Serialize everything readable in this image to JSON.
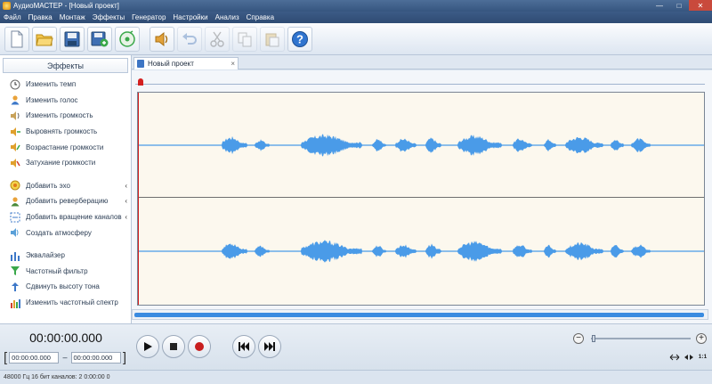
{
  "window": {
    "title": "АудиоМАСТЕР - [Новый проект]"
  },
  "menu": [
    "Файл",
    "Правка",
    "Монтаж",
    "Эффекты",
    "Генератор",
    "Настройки",
    "Анализ",
    "Справка"
  ],
  "toolbar": {
    "buttons": [
      {
        "name": "new-file",
        "icon": "new-file-icon",
        "enabled": true
      },
      {
        "name": "open",
        "icon": "folder-open-icon",
        "enabled": true
      },
      {
        "name": "save",
        "icon": "save-icon",
        "enabled": true
      },
      {
        "name": "save-as",
        "icon": "save-as-icon",
        "enabled": true
      },
      {
        "name": "record",
        "icon": "record-disc-icon",
        "enabled": true
      },
      {
        "name": "effects",
        "icon": "sound-effect-icon",
        "enabled": true
      },
      {
        "name": "undo",
        "icon": "undo-icon",
        "enabled": false
      },
      {
        "name": "cut",
        "icon": "scissors-icon",
        "enabled": false
      },
      {
        "name": "copy",
        "icon": "copy-icon",
        "enabled": false
      },
      {
        "name": "paste",
        "icon": "paste-icon",
        "enabled": false
      },
      {
        "name": "help",
        "icon": "help-icon",
        "enabled": true
      }
    ]
  },
  "sidebar": {
    "title": "Эффекты",
    "groups": [
      [
        {
          "label": "Изменить темп",
          "icon": "clock-icon"
        },
        {
          "label": "Изменить голос",
          "icon": "person-icon"
        },
        {
          "label": "Изменить громкость",
          "icon": "volume-icon"
        },
        {
          "label": "Выровнять громкость",
          "icon": "level-icon"
        },
        {
          "label": "Возрастание громкости",
          "icon": "fade-in-icon"
        },
        {
          "label": "Затухание громкости",
          "icon": "fade-out-icon"
        }
      ],
      [
        {
          "label": "Добавить эхо",
          "icon": "echo-icon",
          "arrow": "‹"
        },
        {
          "label": "Добавить реверберацию",
          "icon": "reverb-icon",
          "arrow": "‹"
        },
        {
          "label": "Добавить вращение каналов",
          "icon": "rotate-channels-icon",
          "arrow": "‹"
        },
        {
          "label": "Создать атмосферу",
          "icon": "atmosphere-icon"
        }
      ],
      [
        {
          "label": "Эквалайзер",
          "icon": "equalizer-icon"
        },
        {
          "label": "Частотный фильтр",
          "icon": "filter-icon"
        },
        {
          "label": "Сдвинуть высоту тона",
          "icon": "pitch-icon"
        },
        {
          "label": "Изменить частотный спектр",
          "icon": "spectrum-icon"
        }
      ]
    ]
  },
  "tabs": [
    {
      "label": "Новый проект",
      "close": "×"
    }
  ],
  "playback": {
    "time": "00:00:00.000",
    "range_start": "00:00:00.000",
    "range_dash": "–",
    "range_end": "00:00:00.000"
  },
  "zoom": {
    "minus": "−",
    "plus": "+",
    "one_to_one": "1:1"
  },
  "status": "48000 Гц  16 бит  каналов: 2   0:00:00 0",
  "colors": {
    "waveform": "#4a9be8",
    "track_bg": "#fcf8ee",
    "playhead": "#d32020",
    "accent": "#3a8be0"
  }
}
